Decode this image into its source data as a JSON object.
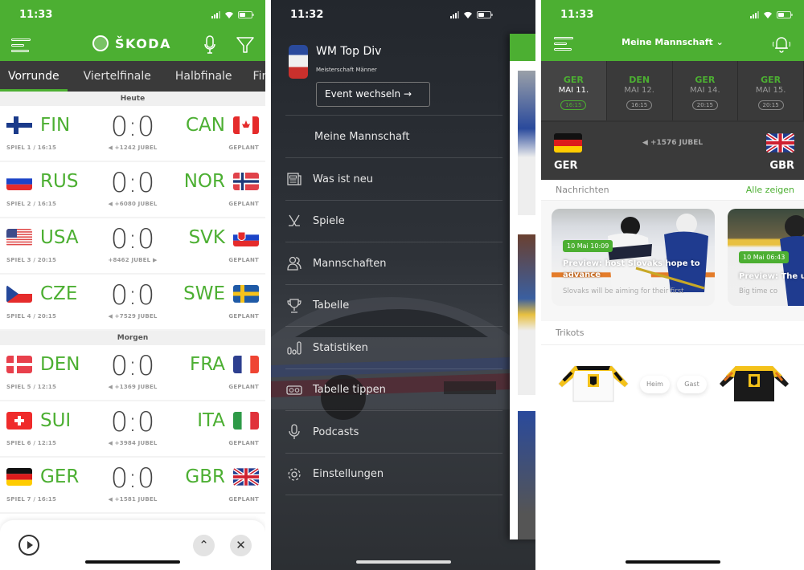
{
  "screen1": {
    "status_time": "11:33",
    "brand": "ŠKODA",
    "tabs": [
      "Vorrunde",
      "Viertelfinale",
      "Halbfinale",
      "Finale"
    ],
    "active_tab": "Vorrunde",
    "sections": [
      {
        "label": "Heute",
        "matches": [
          {
            "home": "FIN",
            "away": "CAN",
            "score": "0:0",
            "info": "SPIEL 1 / 16:15",
            "jubel": "◀ +1242 JUBEL",
            "status": "GEPLANT"
          },
          {
            "home": "RUS",
            "away": "NOR",
            "score": "0:0",
            "info": "SPIEL 2 / 16:15",
            "jubel": "◀ +6080 JUBEL",
            "status": "GEPLANT"
          },
          {
            "home": "USA",
            "away": "SVK",
            "score": "0:0",
            "info": "SPIEL 3 / 20:15",
            "jubel": "+8462 JUBEL ▶",
            "status": "GEPLANT"
          },
          {
            "home": "CZE",
            "away": "SWE",
            "score": "0:0",
            "info": "SPIEL 4 / 20:15",
            "jubel": "◀ +7529 JUBEL",
            "status": "GEPLANT"
          }
        ]
      },
      {
        "label": "Morgen",
        "matches": [
          {
            "home": "DEN",
            "away": "FRA",
            "score": "0:0",
            "info": "SPIEL 5 / 12:15",
            "jubel": "◀ +1369 JUBEL",
            "status": "GEPLANT"
          },
          {
            "home": "SUI",
            "away": "ITA",
            "score": "0:0",
            "info": "SPIEL 6 / 12:15",
            "jubel": "◀ +3984 JUBEL",
            "status": "GEPLANT"
          },
          {
            "home": "GER",
            "away": "GBR",
            "score": "0:0",
            "info": "SPIEL 7 / 16:15",
            "jubel": "◀ +1581 JUBEL",
            "status": "GEPLANT"
          }
        ]
      }
    ],
    "player_controls": {
      "collapse": "⌃",
      "close": "✕"
    }
  },
  "screen2": {
    "status_time": "11:32",
    "event_title": "WM Top Div",
    "event_subtitle": "Meisterschaft Männer",
    "event_button": "Event wechseln  →",
    "menu": [
      {
        "label": "Meine Mannschaft",
        "icon": ""
      },
      {
        "label": "Was ist neu",
        "icon": "news-icon"
      },
      {
        "label": "Spiele",
        "icon": "hockey-sticks-icon"
      },
      {
        "label": "Mannschaften",
        "icon": "team-icon"
      },
      {
        "label": "Tabelle",
        "icon": "trophy-icon"
      },
      {
        "label": "Statistiken",
        "icon": "stats-icon"
      },
      {
        "label": "Tabelle tippen",
        "icon": "scoreboard-icon"
      },
      {
        "label": "Podcasts",
        "icon": "microphone-icon"
      },
      {
        "label": "Einstellungen",
        "icon": "gear-icon"
      }
    ]
  },
  "screen3": {
    "status_time": "11:33",
    "title": "Meine Mannschaft ⌄",
    "games": [
      {
        "team": "GER",
        "date": "MAI 11.",
        "time": "16:15",
        "active": true
      },
      {
        "team": "DEN",
        "date": "MAI 12.",
        "time": "16:15",
        "active": false
      },
      {
        "team": "GER",
        "date": "MAI 14.",
        "time": "20:15",
        "active": false
      },
      {
        "team": "GER",
        "date": "MAI 15.",
        "time": "20:15",
        "active": false
      }
    ],
    "matchup": {
      "home": "GER",
      "away": "GBR",
      "jubel": "◀  +1576 JUBEL"
    },
    "news_header": "Nachrichten",
    "news_link": "Alle zeigen",
    "news": [
      {
        "date": "10 Mai  10:09",
        "title": "Preview: host Slovaks hope to advance",
        "snippet": "Slovaks will be aiming for their first"
      },
      {
        "date": "10 Mai  06:43",
        "title": "Preview: The un",
        "snippet": "Big time co"
      }
    ],
    "trikots_header": "Trikots",
    "jersey_options": [
      "Heim",
      "Gast"
    ]
  },
  "colors": {
    "brand_green": "#4caf32",
    "tab_bar": "#3a3a3a",
    "drawer_bg": "#2b2f36"
  }
}
